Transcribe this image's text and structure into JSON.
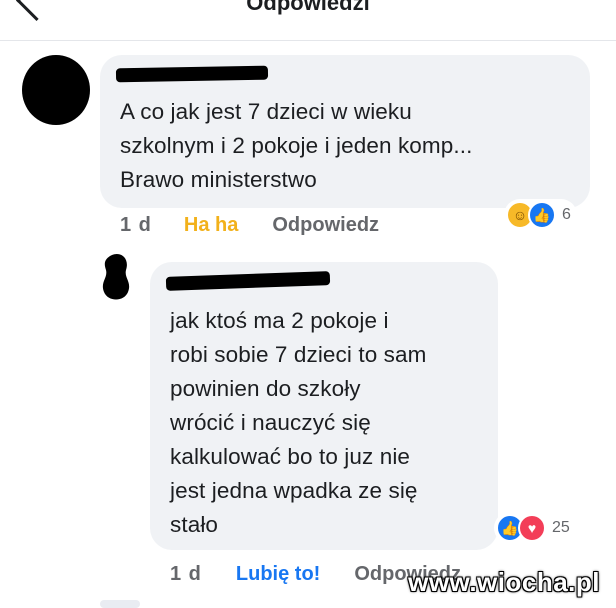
{
  "header": {
    "title": "Odpowiedzi"
  },
  "comments": [
    {
      "text": "A co jak jest 7 dzieci w wieku\nszkolnym i 2 pokoje i jeden komp...\nBrawo ministerstwo",
      "time": "1 d",
      "reaction_action": "Ha ha",
      "reply_label": "Odpowiedz",
      "reaction_count": "6",
      "reaction_icons": [
        "haha-icon",
        "like-icon"
      ]
    },
    {
      "text": "jak ktoś ma 2 pokoje i\nrobi sobie 7 dzieci to sam\npowinien do szkoły\nwrócić i nauczyć się\nkalkulować bo to juz nie\njest jedna wpadka ze się\nstało",
      "time": "1 d",
      "reaction_action": "Lubię to!",
      "reply_label": "Odpowiedz",
      "reaction_count": "25",
      "reaction_icons": [
        "like-icon",
        "love-icon"
      ]
    }
  ],
  "watermark": "www.wiocha.pl",
  "colors": {
    "like": "#1877f2",
    "haha": "#f7b928",
    "love": "#f33e58",
    "bubble": "#f0f2f5",
    "meta": "#65676b"
  }
}
